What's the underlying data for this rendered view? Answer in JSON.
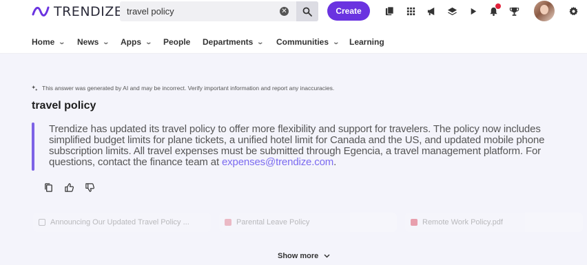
{
  "brand": {
    "name": "TRENDIZE",
    "accent": "#6a33e0"
  },
  "search": {
    "value": "travel policy",
    "clear_icon": "close-icon",
    "button_icon": "search-icon"
  },
  "header": {
    "create_label": "Create",
    "icons": [
      "library-icon",
      "apps-grid-icon",
      "megaphone-icon",
      "layers-icon",
      "play-icon",
      "bell-icon",
      "trophy-icon",
      "avatar",
      "gear-icon"
    ]
  },
  "nav": {
    "items": [
      {
        "label": "Home",
        "dropdown": true
      },
      {
        "label": "News",
        "dropdown": true
      },
      {
        "label": "Apps",
        "dropdown": true
      },
      {
        "label": "People",
        "dropdown": false
      },
      {
        "label": "Departments",
        "dropdown": true
      },
      {
        "label": "Communities",
        "dropdown": true
      },
      {
        "label": "Learning",
        "dropdown": false
      }
    ]
  },
  "answer": {
    "disclaimer": "This answer was generated by AI and may be incorrect. Verify important information and report any inaccuracies.",
    "title": "travel policy",
    "body": "Trendize has updated its travel policy to offer more flexibility and support for travelers. The policy now includes simplified budget limits for plane tickets, a unified hotel limit for Canada and the US, and updated mobile phone subscription limits. All travel expenses must be submitted through Egencia, a travel management platform. For questions, contact the finance team at ",
    "link": "expenses@trendize.com",
    "body_end": ".",
    "accent_bar": "#7d63e6"
  },
  "feedback": {
    "icons": [
      "copy-icon",
      "thumbs-up-icon",
      "thumbs-down-icon"
    ]
  },
  "sources": [
    {
      "label": "Announcing Our Updated Travel Policy ...",
      "icon": "article-icon"
    },
    {
      "label": "Parental Leave Policy",
      "icon": "file-icon"
    },
    {
      "label": "Remote Work Policy.pdf",
      "icon": "pdf-icon"
    }
  ],
  "show_more": {
    "label": "Show more"
  }
}
